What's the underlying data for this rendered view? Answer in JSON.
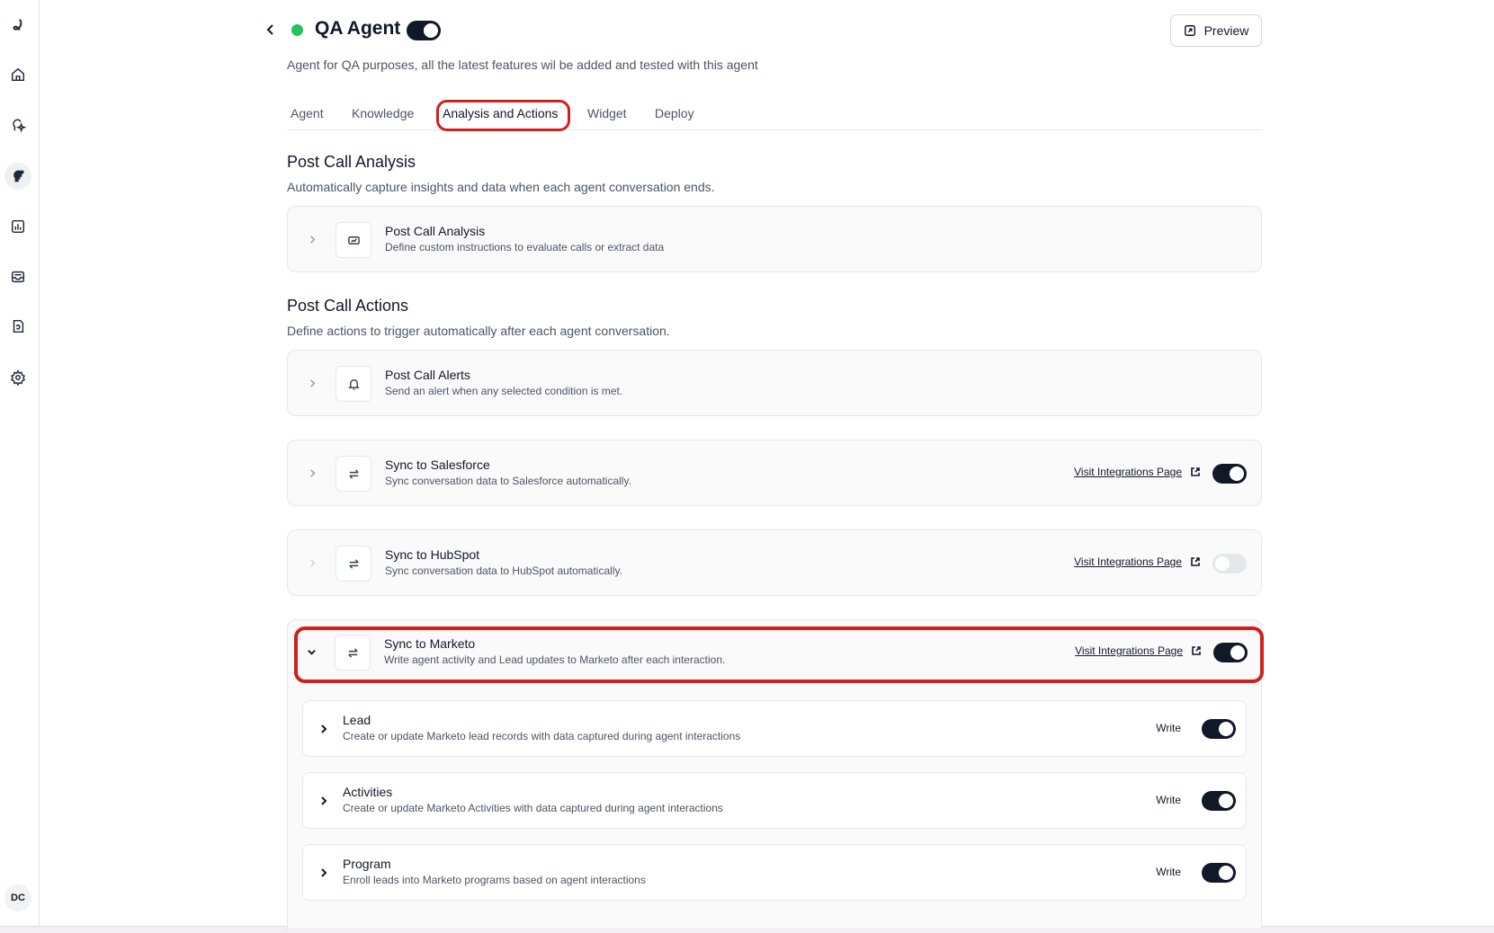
{
  "sidebar": {
    "icons": [
      "logo-icon",
      "home-icon",
      "agent-sparkle-icon",
      "agents-icon",
      "analytics-icon",
      "inbox-icon",
      "knowledge-icon",
      "settings-icon"
    ],
    "avatar_initials": "DC"
  },
  "header": {
    "title": "QA Agent",
    "status": "active",
    "enabled": true,
    "description": "Agent for QA purposes, all the latest features wil be added and tested with this agent",
    "preview_label": "Preview"
  },
  "tabs": {
    "items": [
      "Agent",
      "Knowledge",
      "Analysis and Actions",
      "Widget",
      "Deploy"
    ],
    "active": "Analysis and Actions"
  },
  "post_call_analysis": {
    "title": "Post Call Analysis",
    "subtitle": "Automatically capture insights and data when each agent conversation ends.",
    "card": {
      "title": "Post Call Analysis",
      "description": "Define custom instructions to evaluate calls or extract data"
    }
  },
  "post_call_actions": {
    "title": "Post Call Actions",
    "subtitle": "Define actions to trigger automatically after each agent conversation.",
    "alerts": {
      "title": "Post Call Alerts",
      "description": "Send an alert when any selected condition is met."
    },
    "salesforce": {
      "title": "Sync to Salesforce",
      "description": "Sync conversation data to Salesforce automatically.",
      "link": "Visit Integrations Page",
      "enabled": true
    },
    "hubspot": {
      "title": "Sync to HubSpot",
      "description": "Sync conversation data to HubSpot automatically.",
      "link": "Visit Integrations Page",
      "enabled": false
    },
    "marketo": {
      "title": "Sync to Marketo",
      "description": "Write agent activity and Lead updates to Marketo after each interaction.",
      "link": "Visit Integrations Page",
      "enabled": true,
      "objects": [
        {
          "title": "Lead",
          "description": "Create or update Marketo lead records with data captured during agent interactions",
          "mode": "Write",
          "enabled": true
        },
        {
          "title": "Activities",
          "description": "Create or update Marketo Activities with data captured during agent interactions",
          "mode": "Write",
          "enabled": true
        },
        {
          "title": "Program",
          "description": "Enroll leads into Marketo programs based on agent interactions",
          "mode": "Write",
          "enabled": true
        }
      ]
    }
  },
  "colors": {
    "accent": "#111827",
    "status_green": "#22c55e",
    "highlight_red": "#d0201e",
    "card_bg": "#fafafa"
  }
}
